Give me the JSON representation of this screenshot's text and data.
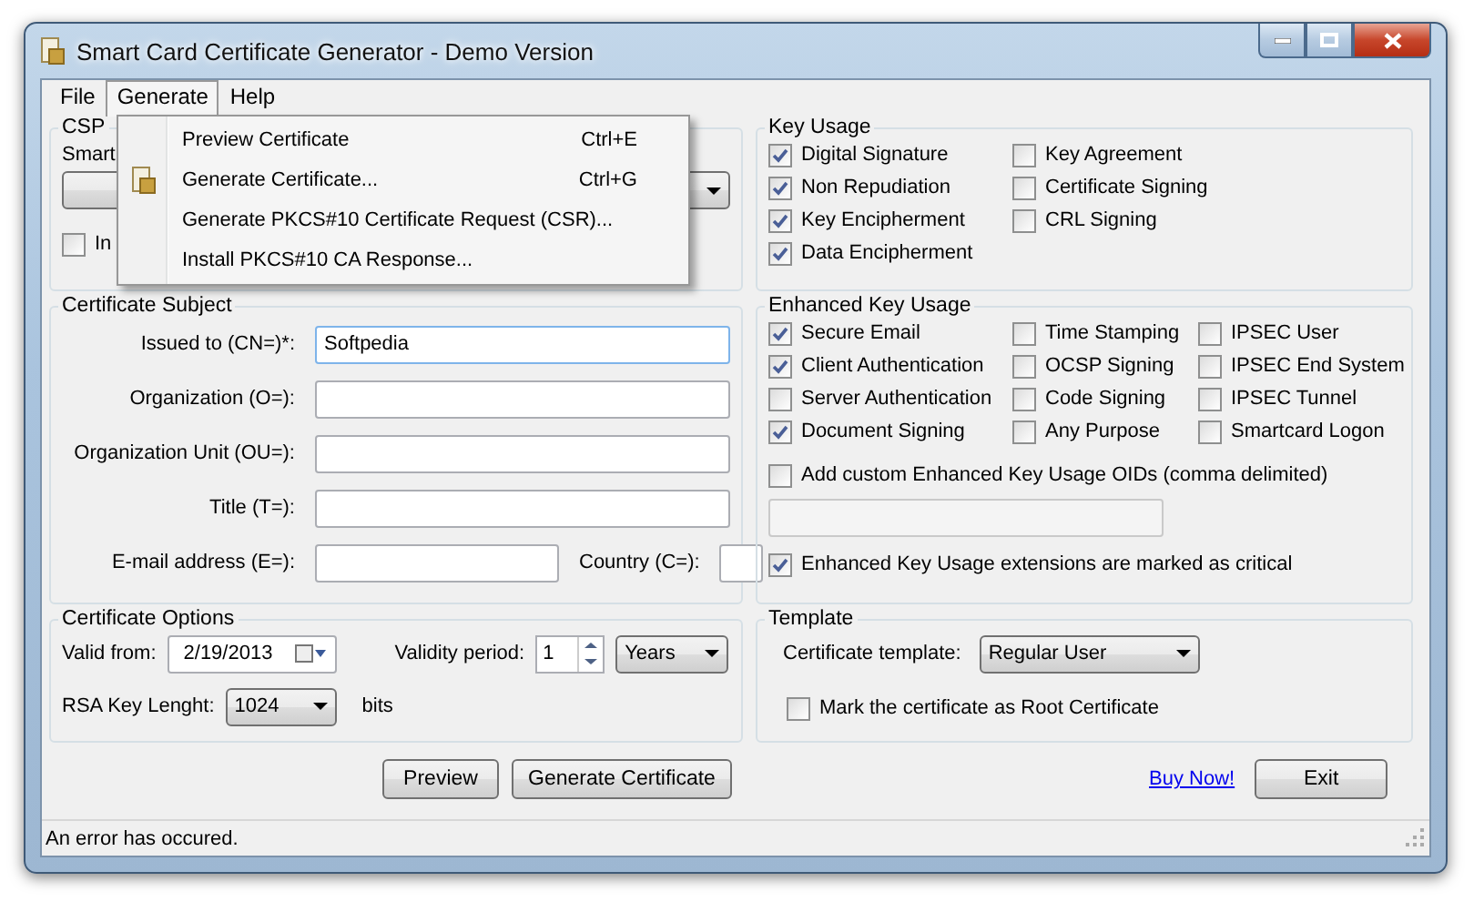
{
  "window": {
    "title": "Smart Card Certificate Generator - Demo Version"
  },
  "menu_bar": [
    {
      "label": "File",
      "selected": false
    },
    {
      "label": "Generate",
      "selected": true
    },
    {
      "label": "Help",
      "selected": false
    }
  ],
  "open_menu": {
    "items": [
      {
        "label": "Preview Certificate",
        "shortcut": "Ctrl+E",
        "has_icon": false
      },
      {
        "label": "Generate Certificate...",
        "shortcut": "Ctrl+G",
        "has_icon": true
      },
      {
        "label": "Generate PKCS#10 Certificate Request (CSR)...",
        "has_icon": false
      },
      {
        "label": "Install PKCS#10 CA Response...",
        "has_icon": false
      }
    ]
  },
  "csp": {
    "title": "CSP",
    "label": "Smart",
    "checkbox": {
      "label": "In",
      "checked": false
    }
  },
  "subject": {
    "title": "Certificate Subject",
    "fields": [
      {
        "label": "Issued to (CN=)*:",
        "value": "Softpedia"
      },
      {
        "label": "Organization (O=):"
      },
      {
        "label": "Organization Unit (OU=):"
      },
      {
        "label": "Title (T=):"
      }
    ],
    "email": {
      "label": "E-mail address (E=):"
    },
    "country": {
      "label": "Country (C=):"
    }
  },
  "options": {
    "title": "Certificate Options",
    "valid_from_label": "Valid from:",
    "valid_from": "2/19/2013",
    "validity_label": "Validity period:",
    "validity_value": "1",
    "validity_unit": "Years",
    "key_length_label": "RSA Key Lenght:",
    "key_length": "1024",
    "key_length_unit": "bits"
  },
  "key_usage": {
    "title": "Key Usage",
    "columns": [
      [
        {
          "label": "Digital Signature",
          "checked": true
        },
        {
          "label": "Non Repudiation",
          "checked": true
        },
        {
          "label": "Key Encipherment",
          "checked": true
        },
        {
          "label": "Data Encipherment",
          "checked": true
        }
      ],
      [
        {
          "label": "Key Agreement",
          "checked": false
        },
        {
          "label": "Certificate Signing",
          "checked": false
        },
        {
          "label": "CRL Signing",
          "checked": false
        }
      ]
    ]
  },
  "enhanced_key_usage": {
    "title": "Enhanced Key Usage",
    "columns": [
      [
        {
          "label": "Secure Email",
          "checked": true
        },
        {
          "label": "Client Authentication",
          "checked": true
        },
        {
          "label": "Server Authentication",
          "checked": false
        },
        {
          "label": "Document Signing",
          "checked": true
        }
      ],
      [
        {
          "label": "Time Stamping",
          "checked": false
        },
        {
          "label": "OCSP Signing",
          "checked": false
        },
        {
          "label": "Code Signing",
          "checked": false
        },
        {
          "label": "Any Purpose",
          "checked": false
        }
      ],
      [
        {
          "label": "IPSEC User",
          "checked": false
        },
        {
          "label": "IPSEC End System",
          "checked": false
        },
        {
          "label": "IPSEC Tunnel",
          "checked": false
        },
        {
          "label": "Smartcard Logon",
          "checked": false
        }
      ]
    ],
    "custom": {
      "label": "Add custom Enhanced Key Usage OIDs (comma delimited)",
      "checked": false
    },
    "critical": {
      "label": "Enhanced Key Usage extensions are marked as critical",
      "checked": true
    }
  },
  "template": {
    "title": "Template",
    "label": "Certificate template:",
    "value": "Regular User",
    "root": {
      "label": "Mark the certificate as Root Certificate",
      "checked": false
    }
  },
  "buttons": {
    "preview": "Preview",
    "generate": "Generate Certificate",
    "buy_link": "Buy Now!",
    "exit": "Exit"
  },
  "status_bar": {
    "text": "An error has occured."
  }
}
